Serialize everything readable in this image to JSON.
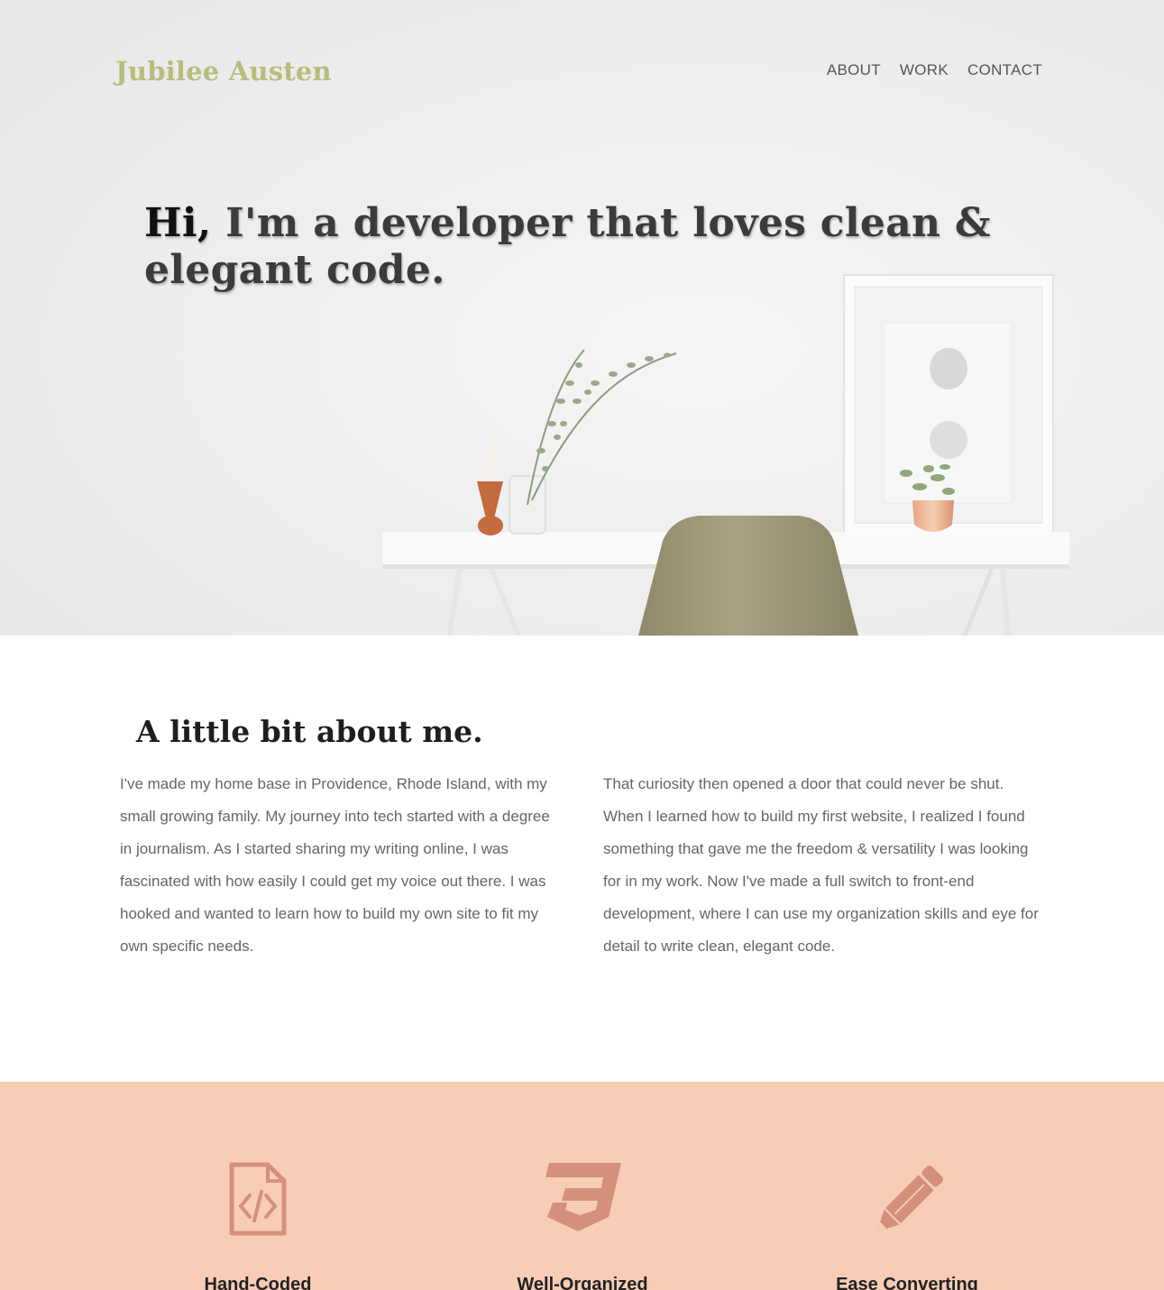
{
  "header": {
    "logo": "Jubilee Austen",
    "nav": [
      {
        "label": "ABOUT"
      },
      {
        "label": "WORK"
      },
      {
        "label": "CONTACT"
      }
    ]
  },
  "hero": {
    "greeting": "Hi,",
    "headline": " I'm a developer that loves clean & elegant code."
  },
  "about": {
    "title": "A little bit about me.",
    "paragraph_left": "I've made my home base in Providence, Rhode Island, with my small growing family. My journey into tech started with a degree in journalism. As I started sharing my writing online, I was fascinated with how easily I could get my voice out there. I was hooked and wanted to learn how to build my own site to fit my own specific needs.",
    "paragraph_right": "That curiosity then opened a door that could never be shut. When I learned how to build my first website, I realized I found something that gave me the freedom & versatility I was looking for in my work. Now I've made a full switch to front-end development, where I can use my organization skills and eye for detail to write clean, elegant code."
  },
  "features": [
    {
      "icon": "code-file-icon",
      "label": "Hand-Coded"
    },
    {
      "icon": "css3-icon",
      "label": "Well-Organized"
    },
    {
      "icon": "pencil-icon",
      "label": "Ease Converting"
    }
  ],
  "colors": {
    "logo": "#b9bd7c",
    "features_background": "#f8cdb5",
    "icon": "#d4907a",
    "text": "#666666"
  }
}
